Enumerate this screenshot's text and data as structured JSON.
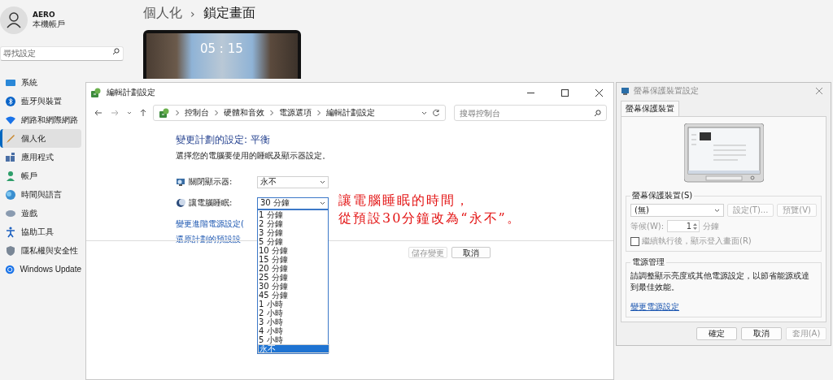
{
  "settings": {
    "account": {
      "name": "AERO",
      "type": "本機帳戶"
    },
    "search": {
      "placeholder": "尋找設定"
    },
    "nav": [
      {
        "label": "系統",
        "kind": "system",
        "selected": false
      },
      {
        "label": "藍牙與裝置",
        "kind": "bluetooth",
        "selected": false
      },
      {
        "label": "網路和網際網路",
        "kind": "network",
        "selected": false
      },
      {
        "label": "個人化",
        "kind": "brush",
        "selected": true
      },
      {
        "label": "應用程式",
        "kind": "apps",
        "selected": false
      },
      {
        "label": "帳戶",
        "kind": "account",
        "selected": false
      },
      {
        "label": "時間與語言",
        "kind": "time",
        "selected": false
      },
      {
        "label": "遊戲",
        "kind": "gaming",
        "selected": false
      },
      {
        "label": "協助工具",
        "kind": "accessibility",
        "selected": false
      },
      {
        "label": "隱私權與安全性",
        "kind": "privacy",
        "selected": false
      },
      {
        "label": "Windows Update",
        "kind": "update",
        "selected": false
      }
    ],
    "breadcrumb": {
      "parent": "個人化",
      "separator": "›",
      "current": "鎖定畫面"
    },
    "lock_preview": {
      "time": "05 : 15"
    }
  },
  "plan_window": {
    "title": "編輯計劃設定",
    "address": [
      "控制台",
      "硬體和音效",
      "電源選項",
      "編輯計劃設定"
    ],
    "search": {
      "placeholder": "搜尋控制台"
    },
    "heading": "變更計劃的設定: 平衡",
    "description": "選擇您的電腦要使用的睡眠及顯示器設定。",
    "rows": [
      {
        "kind": "display",
        "label": "關閉顯示器:",
        "value": "永不",
        "focused": false
      },
      {
        "kind": "sleep",
        "label": "讓電腦睡眠:",
        "value": "30 分鐘",
        "focused": true
      }
    ],
    "sleep_options": [
      {
        "label": "1 分鐘",
        "selected": false
      },
      {
        "label": "2 分鐘",
        "selected": false
      },
      {
        "label": "3 分鐘",
        "selected": false
      },
      {
        "label": "5 分鐘",
        "selected": false
      },
      {
        "label": "10 分鐘",
        "selected": false
      },
      {
        "label": "15 分鐘",
        "selected": false
      },
      {
        "label": "20 分鐘",
        "selected": false
      },
      {
        "label": "25 分鐘",
        "selected": false
      },
      {
        "label": "30 分鐘",
        "selected": false
      },
      {
        "label": "45 分鐘",
        "selected": false
      },
      {
        "label": "1 小時",
        "selected": false
      },
      {
        "label": "2 小時",
        "selected": false
      },
      {
        "label": "3 小時",
        "selected": false
      },
      {
        "label": "4 小時",
        "selected": false
      },
      {
        "label": "5 小時",
        "selected": false
      },
      {
        "label": "永不",
        "selected": true
      }
    ],
    "links": [
      "變更進階電源設定(",
      "還原計劃的預設設"
    ],
    "buttons": [
      {
        "label": "儲存變更",
        "disabled": true
      },
      {
        "label": "取消",
        "disabled": false
      }
    ]
  },
  "annotation": {
    "lines": [
      "讓電腦睡眠的時間，",
      "從預設30分鐘改為“永不”。"
    ]
  },
  "saver_dialog": {
    "title": "螢幕保護裝置設定",
    "tabs": [
      {
        "label": "螢幕保護裝置",
        "selected": true
      }
    ],
    "saver_group": {
      "label": "螢幕保護裝置(S)",
      "value": "(無)",
      "buttons": [
        {
          "label": "設定(T)...",
          "disabled": true
        },
        {
          "label": "預覽(V)",
          "disabled": true
        }
      ],
      "wait": {
        "label": "等候(W):",
        "value": "1",
        "unit": "分鐘",
        "disabled": true
      },
      "resume_checkbox": {
        "label": "繼續執行後，顯示登入畫面(R)",
        "checked": false
      }
    },
    "power_group": {
      "label": "電源管理",
      "text": "請調整顯示亮度或其他電源設定，以節省能源或達到最佳效能。",
      "link": "變更電源設定"
    },
    "buttons": [
      {
        "label": "確定",
        "disabled": false
      },
      {
        "label": "取消",
        "disabled": false
      },
      {
        "label": "套用(A)",
        "disabled": true
      }
    ]
  }
}
